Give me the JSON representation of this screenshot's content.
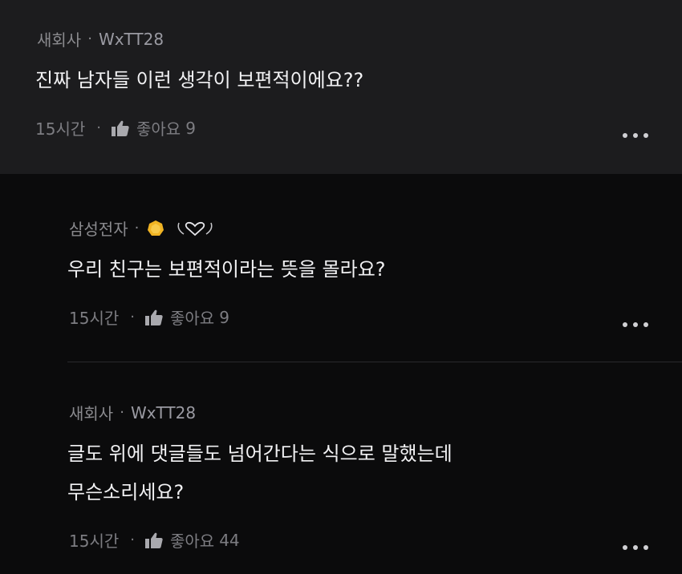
{
  "comments": [
    {
      "author": "새회사",
      "handle": "WxTT28",
      "text": "진짜 남자들 이런 생각이 보편적이에요??",
      "time": "15시간",
      "like_label": "좋아요",
      "like_count": "9"
    },
    {
      "author": "삼성전자",
      "text": "우리 친구는 보편적이라는 뜻을 몰라요?",
      "time": "15시간",
      "like_label": "좋아요",
      "like_count": "9"
    },
    {
      "author": "새회사",
      "handle": "WxTT28",
      "text_line1": "글도 위에 댓글들도 넘어간다는 식으로 말했는데",
      "text_line2": "무슨소리세요?",
      "time": "15시간",
      "like_label": "좋아요",
      "like_count": "44"
    }
  ],
  "separator": "·",
  "icons": {
    "like": "thumbs-up-icon",
    "more": "more-options-icon",
    "badge": "gold-badge-icon",
    "heart_badge": "heart-wings-icon"
  },
  "colors": {
    "top_bg": "#1c1c1e",
    "page_bg": "#0b0b0c",
    "text": "#f2f2f4",
    "muted": "#8a8a8e",
    "coin": "#f0b323"
  }
}
